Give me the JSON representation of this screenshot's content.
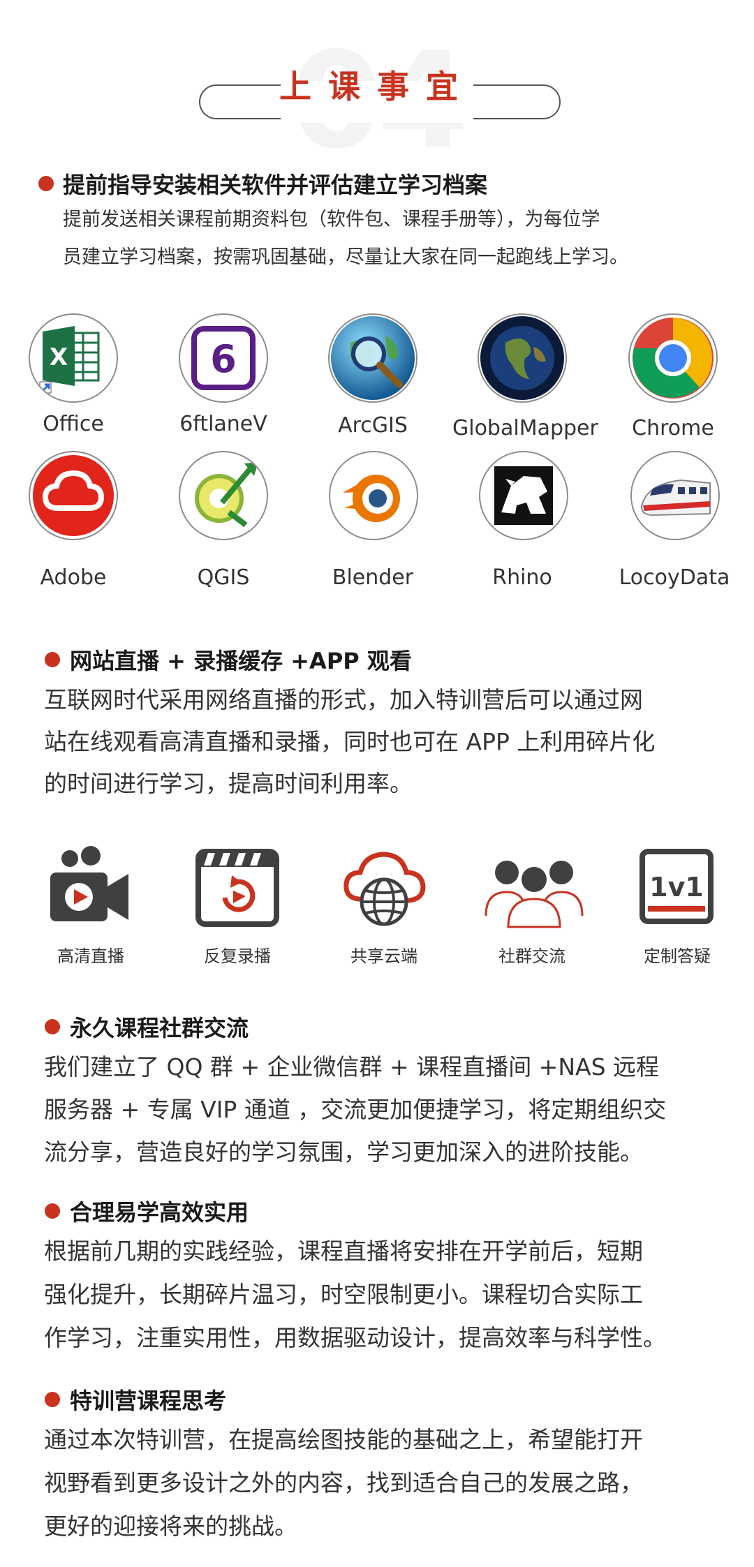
{
  "header": {
    "number": "04",
    "title": "上课事宜"
  },
  "sections": [
    {
      "title": "提前指导安装相关软件并评估建立学习档案",
      "lines": [
        "提前发送相关课程前期资料包（软件包、课程手册等），为每位学",
        "员建立学习档案，按需巩固基础，尽量让大家在同一起跑线上学习。"
      ]
    },
    {
      "title": "网站直播 + 录播缓存 +APP 观看",
      "lines": [
        "互联网时代采用网络直播的形式，加入特训营后可以通过网",
        "站在线观看高清直播和录播，同时也可在 APP 上利用碎片化",
        "的时间进行学习，提高时间利用率。"
      ]
    },
    {
      "title": "永久课程社群交流",
      "lines": [
        "我们建立了 QQ 群 + 企业微信群 + 课程直播间 +NAS 远程",
        "服务器 + 专属 VIP 通道 ，交流更加便捷学习，将定期组织交",
        "流分享，营造良好的学习氛围，学习更加深入的进阶技能。"
      ]
    },
    {
      "title": "合理易学高效实用",
      "lines": [
        "根据前几期的实践经验，课程直播将安排在开学前后，短期",
        "强化提升，长期碎片温习，时空限制更小。课程切合实际工",
        "作学习，注重实用性，用数据驱动设计，提高效率与科学性。"
      ]
    },
    {
      "title": "特训营课程思考",
      "lines": [
        "通过本次特训营，在提高绘图技能的基础之上，希望能打开",
        "视野看到更多设计之外的内容，找到适合自己的发展之路，",
        "更好的迎接将来的挑战。"
      ]
    }
  ],
  "software": [
    {
      "label": "Office",
      "icon": "excel-icon"
    },
    {
      "label": "6ftlaneV",
      "icon": "6ftlanev-icon"
    },
    {
      "label": "ArcGIS",
      "icon": "arcgis-globe-icon"
    },
    {
      "label": "GlobalMapper",
      "icon": "globalmapper-globe-icon"
    },
    {
      "label": "Chrome",
      "icon": "chrome-icon"
    },
    {
      "label": "Adobe",
      "icon": "adobe-cc-icon"
    },
    {
      "label": "QGIS",
      "icon": "qgis-icon"
    },
    {
      "label": "Blender",
      "icon": "blender-icon"
    },
    {
      "label": "Rhino",
      "icon": "rhino-icon"
    },
    {
      "label": "LocoyData",
      "icon": "train-icon"
    }
  ],
  "six_icon_digit": "6",
  "excel_letter": "X",
  "features": [
    {
      "label": "高清直播",
      "icon": "video-camera-icon"
    },
    {
      "label": "反复录播",
      "icon": "replay-clapper-icon"
    },
    {
      "label": "共享云端",
      "icon": "cloud-globe-icon"
    },
    {
      "label": "社群交流",
      "icon": "community-icon"
    },
    {
      "label": "定制答疑",
      "icon": "one-on-one-icon"
    }
  ],
  "oneonone_text": "1v1",
  "colors": {
    "accent": "#c8321e",
    "icon_gray": "#404040",
    "text": "#333333"
  }
}
